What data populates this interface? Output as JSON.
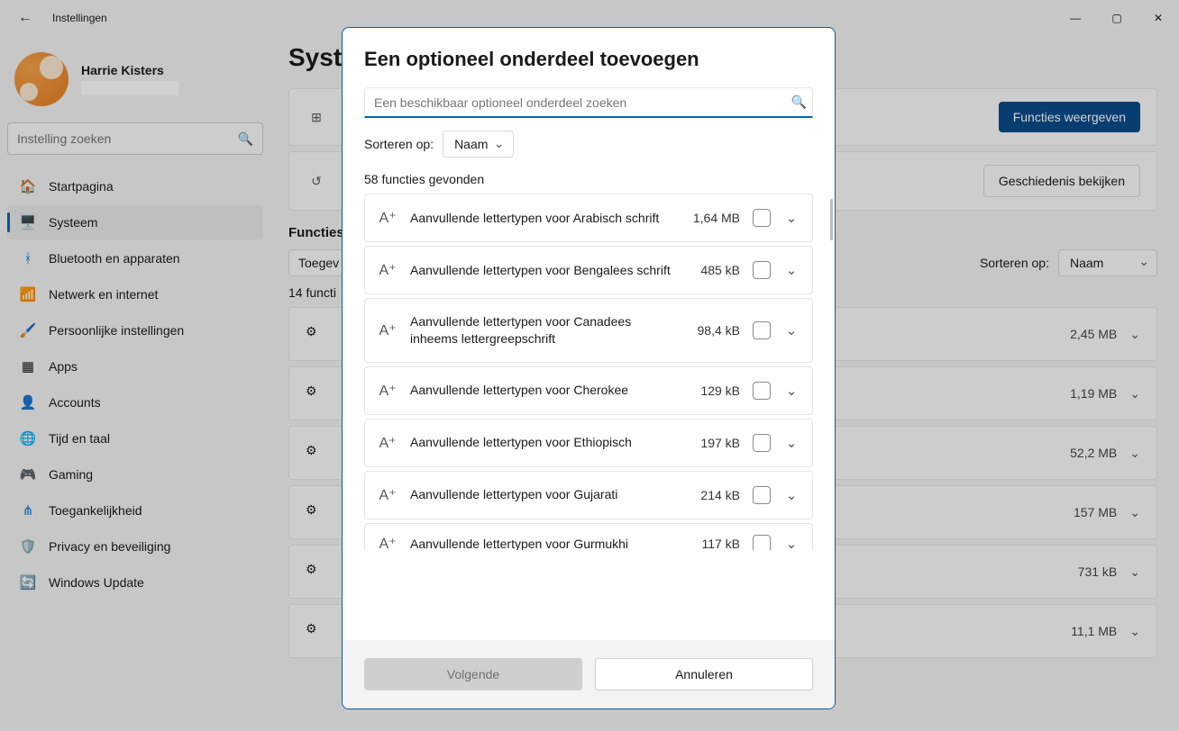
{
  "titlebar": {
    "title": "Instellingen"
  },
  "profile": {
    "name": "Harrie Kisters"
  },
  "sidebar_search": {
    "placeholder": "Instelling zoeken"
  },
  "nav": [
    {
      "icon": "🏠",
      "label": "Startpagina",
      "active": false
    },
    {
      "icon": "🖥️",
      "label": "Systeem",
      "active": true
    },
    {
      "icon": "ᚼ",
      "label": "Bluetooth en apparaten",
      "active": false,
      "color": "#0078d4"
    },
    {
      "icon": "📶",
      "label": "Netwerk en internet",
      "active": false
    },
    {
      "icon": "🖌️",
      "label": "Persoonlijke instellingen",
      "active": false
    },
    {
      "icon": "▦",
      "label": "Apps",
      "active": false
    },
    {
      "icon": "👤",
      "label": "Accounts",
      "active": false
    },
    {
      "icon": "🌐",
      "label": "Tijd en taal",
      "active": false
    },
    {
      "icon": "🎮",
      "label": "Gaming",
      "active": false
    },
    {
      "icon": "⋔",
      "label": "Toegankelijkheid",
      "active": false,
      "color": "#0078d4"
    },
    {
      "icon": "🛡️",
      "label": "Privacy en beveiliging",
      "active": false
    },
    {
      "icon": "🔄",
      "label": "Windows Update",
      "active": false
    }
  ],
  "main": {
    "heading": "Syste",
    "card1_btn": "Functies weergeven",
    "card2_btn": "Geschiedenis bekijken",
    "sub": "Functies",
    "filter_chip": "Toegev",
    "sort_label": "Sorteren op:",
    "sort_value": "Naam",
    "count": "14 functi",
    "rows": [
      {
        "size": "2,45 MB"
      },
      {
        "size": "1,19 MB"
      },
      {
        "size": "52,2 MB"
      },
      {
        "size": "157 MB"
      },
      {
        "size": "731 kB"
      },
      {
        "size": "11,1 MB"
      }
    ]
  },
  "modal": {
    "title": "Een optioneel onderdeel toevoegen",
    "search_placeholder": "Een beschikbaar optioneel onderdeel zoeken",
    "sort_label": "Sorteren op:",
    "sort_value": "Naam",
    "found": "58 functies gevonden",
    "rows": [
      {
        "label": "Aanvullende lettertypen voor Arabisch schrift",
        "size": "1,64 MB"
      },
      {
        "label": "Aanvullende lettertypen voor Bengalees schrift",
        "size": "485 kB"
      },
      {
        "label": "Aanvullende lettertypen voor Canadees inheems lettergreepschrift",
        "size": "98,4 kB"
      },
      {
        "label": "Aanvullende lettertypen voor Cherokee",
        "size": "129 kB"
      },
      {
        "label": "Aanvullende lettertypen voor Ethiopisch",
        "size": "197 kB"
      },
      {
        "label": "Aanvullende lettertypen voor Gujarati",
        "size": "214 kB"
      },
      {
        "label": "Aanvullende lettertypen voor Gurmukhi",
        "size": "117 kB"
      }
    ],
    "next": "Volgende",
    "cancel": "Annuleren"
  }
}
